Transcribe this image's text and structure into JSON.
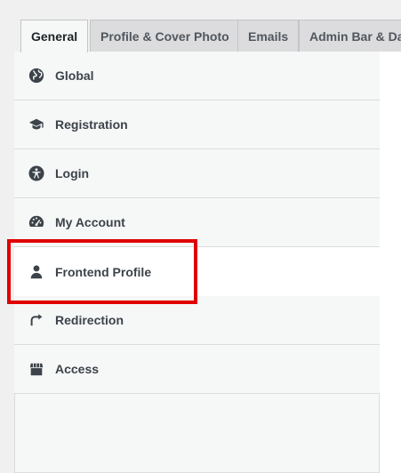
{
  "tabs": [
    {
      "label": "General"
    },
    {
      "label": "Profile & Cover Photo"
    },
    {
      "label": "Emails"
    },
    {
      "label": "Admin Bar & Das"
    }
  ],
  "menu": [
    {
      "label": "Global",
      "icon": "globe-icon"
    },
    {
      "label": "Registration",
      "icon": "graduation-cap-icon"
    },
    {
      "label": "Login",
      "icon": "accessibility-icon"
    },
    {
      "label": "My Account",
      "icon": "dashboard-gauge-icon"
    },
    {
      "label": "Frontend Profile",
      "icon": "user-icon"
    },
    {
      "label": "Redirection",
      "icon": "redirect-arrow-icon"
    },
    {
      "label": "Access",
      "icon": "store-icon"
    }
  ],
  "colors": {
    "highlight": "#e00000",
    "icon": "#3c434a"
  }
}
